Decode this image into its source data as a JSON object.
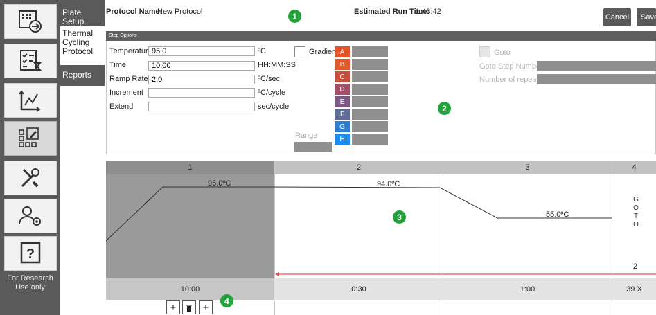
{
  "rail": {
    "buttons": [
      {
        "name": "open-file-icon"
      },
      {
        "name": "checklist-timer-icon"
      },
      {
        "name": "analysis-chart-icon"
      },
      {
        "name": "plate-edit-icon"
      },
      {
        "name": "tools-icon"
      },
      {
        "name": "user-settings-icon"
      },
      {
        "name": "help-icon"
      }
    ],
    "note_line1": "For Research",
    "note_line2": "Use only"
  },
  "nav": {
    "plate_setup": "Plate Setup",
    "thermal_cycling": "Thermal Cycling Protocol",
    "reports": "Reports"
  },
  "header": {
    "protocol_name_label": "Protocol Name:",
    "protocol_name": "New Protocol",
    "run_time_label": "Estimated Run Time:",
    "run_time": "1:43:42",
    "cancel": "Cancel",
    "save": "Save"
  },
  "badges": [
    "1",
    "2",
    "3",
    "4"
  ],
  "step_options": {
    "title": "Step Options",
    "temperature_label": "Temperature",
    "temperature_value": "95.0",
    "temperature_unit": "ºC",
    "time_label": "Time",
    "time_value": "10:00",
    "time_unit": "HH:MM:SS",
    "ramp_label": "Ramp Rate",
    "ramp_value": "2.0",
    "ramp_unit": "ºC/sec",
    "increment_label": "Increment",
    "increment_value": "",
    "increment_unit": "ºC/cycle",
    "extend_label": "Extend",
    "extend_value": "",
    "extend_unit": "sec/cycle",
    "gradient_label": "Gradient",
    "range_label": "Range",
    "goto_label": "Goto",
    "goto_step_label": "Goto Step Number",
    "repeats_label": "Number of repeats",
    "rows": [
      {
        "letter": "A",
        "color": "#e5532a"
      },
      {
        "letter": "B",
        "color": "#e05a2b"
      },
      {
        "letter": "C",
        "color": "#c94e3c"
      },
      {
        "letter": "D",
        "color": "#a2506a"
      },
      {
        "letter": "E",
        "color": "#7c5885"
      },
      {
        "letter": "F",
        "color": "#5f6c9a"
      },
      {
        "letter": "G",
        "color": "#2f7ed0"
      },
      {
        "letter": "H",
        "color": "#1a8cf0"
      }
    ]
  },
  "protocol": {
    "steps": [
      {
        "number": "1",
        "temp": "95.0ºC",
        "duration": "10:00"
      },
      {
        "number": "2",
        "temp": "94.0ºC",
        "duration": "0:30"
      },
      {
        "number": "3",
        "temp": "55.0ºC",
        "duration": "1:00"
      },
      {
        "number": "4",
        "goto_letters": [
          "G",
          "O",
          "T",
          "O"
        ],
        "goto_target": "2",
        "cycles": "39 X"
      }
    ]
  }
}
